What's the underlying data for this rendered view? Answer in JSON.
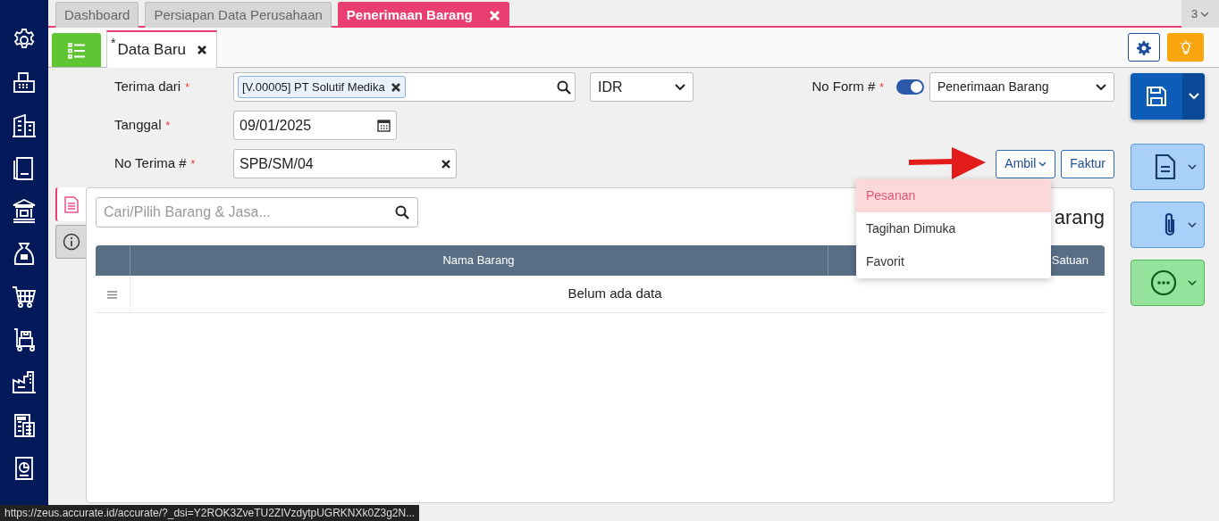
{
  "tabs": [
    {
      "label": "Dashboard",
      "selected": false
    },
    {
      "label": "Persiapan Data Perusahaan",
      "selected": false
    },
    {
      "label": "Penerimaan Barang",
      "selected": true
    }
  ],
  "tab_overflow": "3",
  "doc_tabs": [
    {
      "mark": "*",
      "label": "Data Baru",
      "selected": true
    }
  ],
  "form": {
    "terima_dari": {
      "label": "Terima dari",
      "mark": "*",
      "tag": "[V.00005] PT Solutif Medika"
    },
    "currency": "IDR",
    "no_form": {
      "label": "No Form #",
      "mark": "*",
      "on": true,
      "value": "Penerimaan Barang"
    },
    "tanggal": {
      "label": "Tanggal",
      "mark": "*",
      "value": "09/01/2025"
    },
    "no_terima": {
      "label": "No Terima #",
      "mark": "*",
      "value": "SPB/SM/04"
    }
  },
  "buttons": [
    {
      "label": "Ambil",
      "kind": "dropdown"
    },
    {
      "label": "Faktur",
      "kind": "plain"
    }
  ],
  "menu": [
    {
      "label": "Pesanan",
      "selected": true
    },
    {
      "label": "Tagihan Dimuka",
      "selected": false
    },
    {
      "label": "Favorit",
      "selected": false
    }
  ],
  "side_tabs": [
    {
      "kind": "document",
      "selected": true
    },
    {
      "kind": "info",
      "selected": false
    }
  ],
  "search": {
    "placeholder": "Cari/Pilih Barang & Jasa..."
  },
  "panel_title": "arang",
  "table": {
    "columns": [
      {
        "label": "Nama Barang"
      },
      {
        "label": "Satuan"
      }
    ],
    "empty_message": "Belum ada data"
  },
  "status_url": "https://zeus.accurate.id/accurate/?_dsi=Y2ROK3ZveTU2ZIVzdytpUGRKNXk0Z3g2N..."
}
